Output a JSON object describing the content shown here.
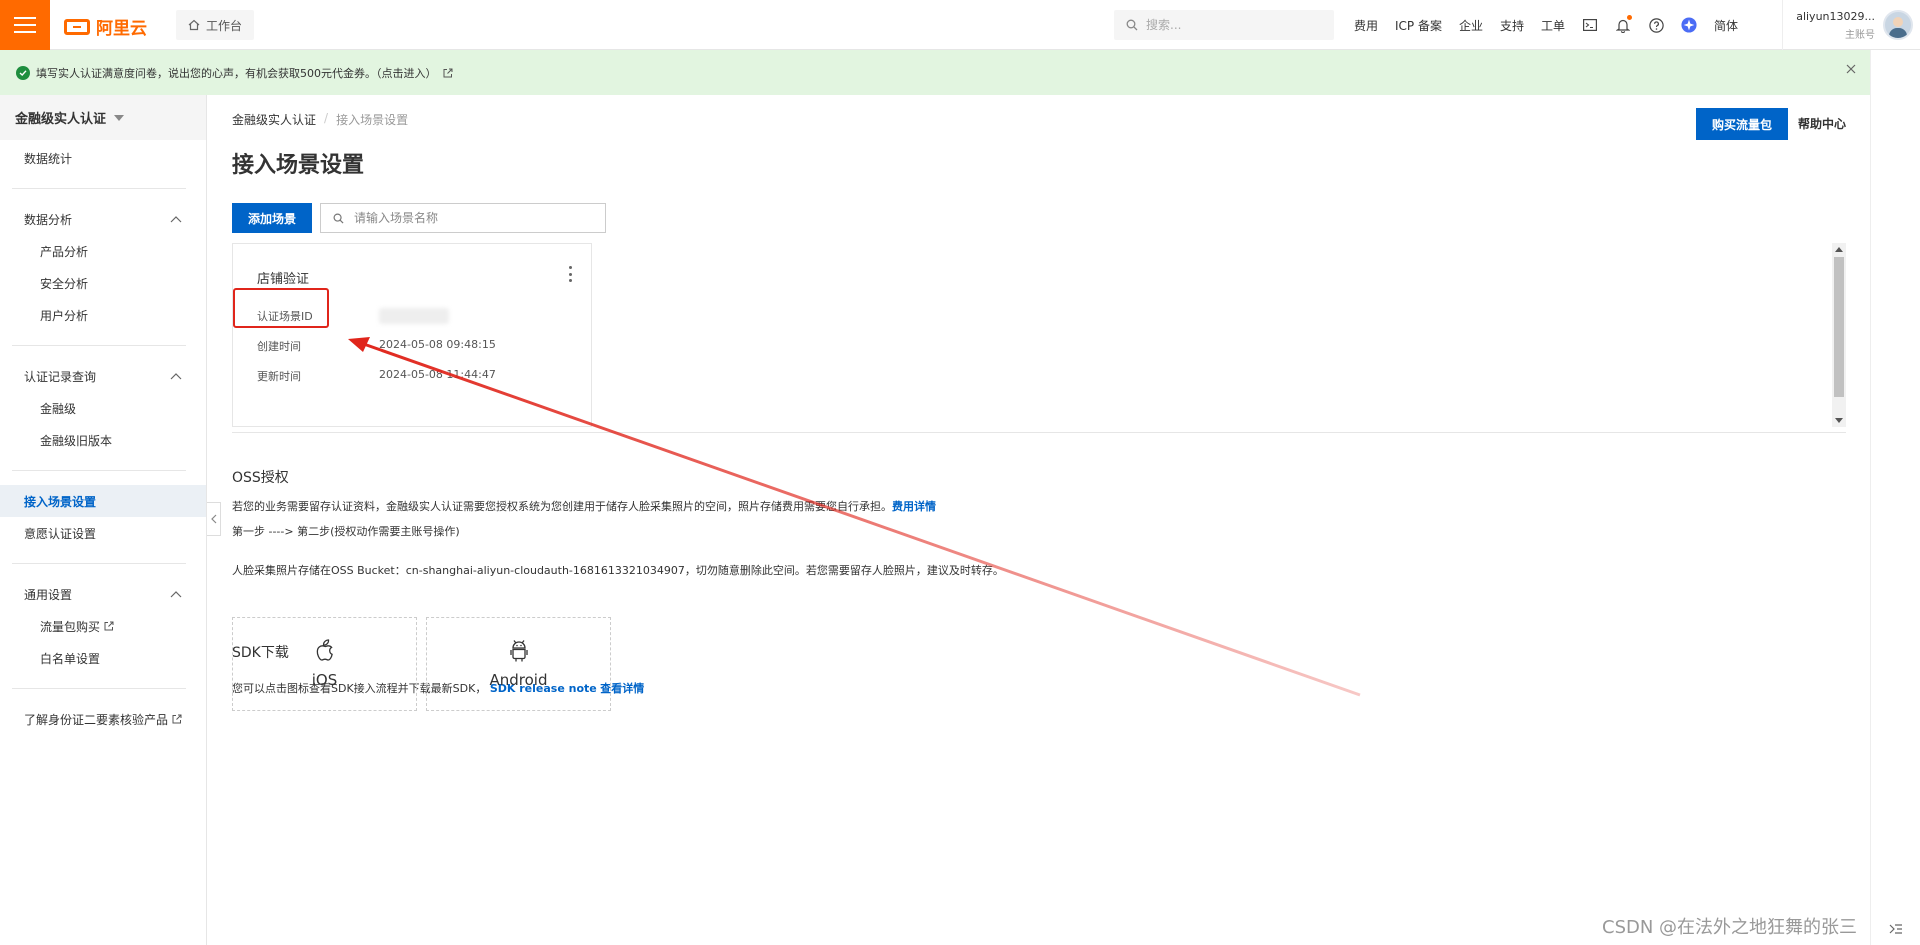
{
  "topbar": {
    "logo_text": "阿里云",
    "workbench_label": "工作台",
    "search_placeholder": "搜索...",
    "nav_links": [
      "费用",
      "ICP 备案",
      "企业",
      "支持",
      "工单"
    ],
    "lang_label": "简体",
    "user_name": "aliyun13029...",
    "user_role": "主账号",
    "accent_color": "#ff6a00"
  },
  "notice": {
    "text": "填写实人认证满意度问卷，说出您的心声，有机会获取500元代金券。（点击进入）"
  },
  "sidebar": {
    "title": "金融级实人认证",
    "items": {
      "data_stats": "数据统计",
      "data_analysis": "数据分析",
      "product_analysis": "产品分析",
      "security_analysis": "安全分析",
      "user_analysis": "用户分析",
      "record_query": "认证记录查询",
      "finance_level": "金融级",
      "finance_old": "金融级旧版本",
      "scene_settings": "接入场景设置",
      "intent_settings": "意愿认证设置",
      "general_settings": "通用设置",
      "traffic_purchase": "流量包购买",
      "whitelist": "白名单设置",
      "learn_more": "了解身份证二要素核验产品"
    }
  },
  "breadcrumb": {
    "parent": "金融级实人认证",
    "separator": "/",
    "current": "接入场景设置"
  },
  "page": {
    "title": "接入场景设置",
    "buy_button": "购买流量包",
    "help_link": "帮助中心",
    "add_button": "添加场景",
    "search_placeholder": "请输入场景名称",
    "primary_color": "#0064c8"
  },
  "scene_card": {
    "title": "店铺验证",
    "id_label": "认证场景ID",
    "created_label": "创建时间",
    "created_value": "2024-05-08 09:48:15",
    "updated_label": "更新时间",
    "updated_value": "2024-05-08 11:44:47",
    "highlight_color": "#e0251b"
  },
  "oss": {
    "heading": "OSS授权",
    "line1": "若您的业务需要留存认证资料，金融级实人认证需要您授权系统为您创建用于储存人脸采集照片的空间，照片存储费用需要您自行承担。",
    "line1_link": "费用详情",
    "line2": "第一步 ----> 第二步(授权动作需要主账号操作)",
    "line3": "人脸采集照片存储在OSS Bucket：cn-shanghai-aliyun-cloudauth-1681613321034907，切勿随意删除此空间。若您需要留存人脸照片，建议及时转存。"
  },
  "sdk": {
    "heading": "SDK下载",
    "desc": "您可以点击图标查看SDK接入流程并下载最新SDK，",
    "release_link": "SDK release note",
    "detail_link": "查看详情",
    "ios_label": "iOS",
    "android_label": "Android"
  },
  "watermark": "CSDN @在法外之地狂舞的张三"
}
